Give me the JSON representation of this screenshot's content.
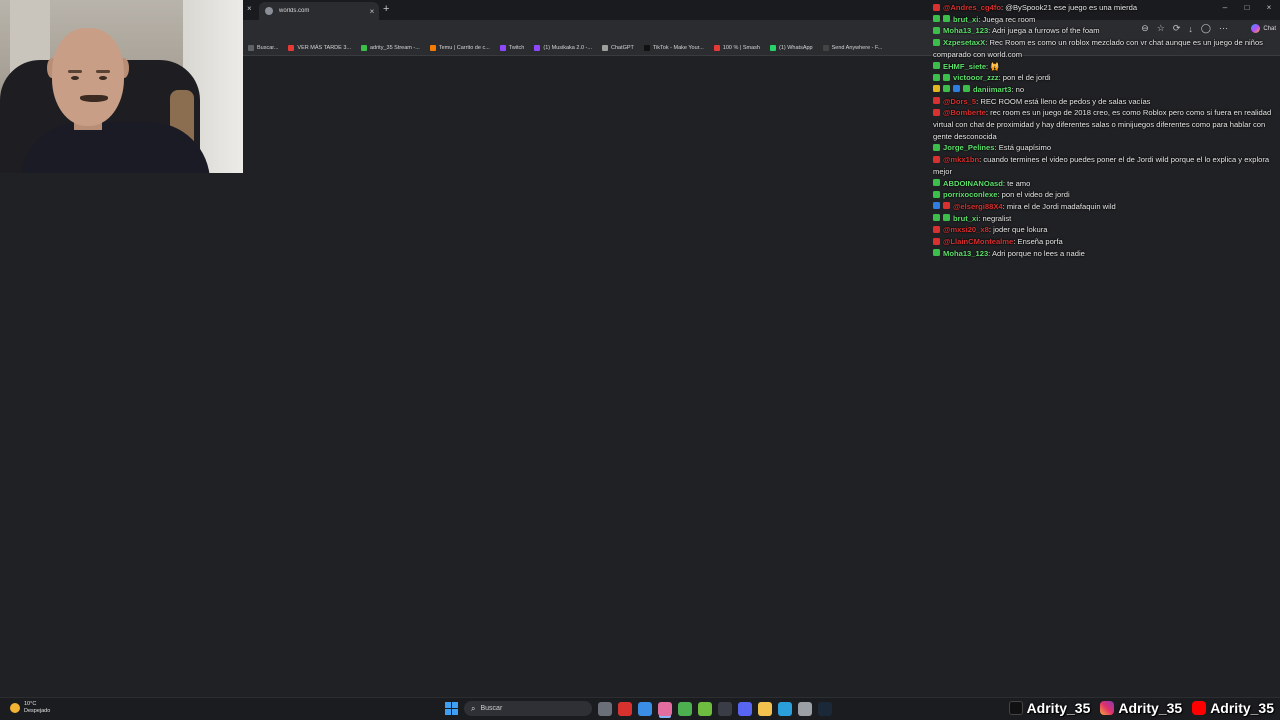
{
  "browser": {
    "tab_title": "worlds.com",
    "tab_close": "×",
    "new_tab": "+",
    "window_controls": [
      "–",
      "□",
      "×"
    ],
    "left_close": "×"
  },
  "toolbar": {
    "icons": [
      "⊖",
      "☆",
      "⟳",
      "↓",
      "◯",
      "⋯"
    ],
    "chat_label": "Chat"
  },
  "bookmarks": [
    {
      "label": "Buscar...",
      "color": "#5f6368"
    },
    {
      "label": "VER MÁS TARDE 3...",
      "color": "#e53935"
    },
    {
      "label": "adrity_35 Stream -...",
      "color": "#3bbf4a"
    },
    {
      "label": "Temu | Carrito de c...",
      "color": "#f57c00"
    },
    {
      "label": "Twitch",
      "color": "#9146ff"
    },
    {
      "label": "(1) Musikaka 2.0 -...",
      "color": "#9146ff"
    },
    {
      "label": "ChatGPT",
      "color": "#9e9e9e"
    },
    {
      "label": "TikTok - Make Your...",
      "color": "#111111"
    },
    {
      "label": "100 % | Smash",
      "color": "#e53935"
    },
    {
      "label": "(1) WhatsApp",
      "color": "#25d366"
    },
    {
      "label": "Send Anywhere - F...",
      "color": "#444444"
    }
  ],
  "chat": [
    {
      "user": "@Andres_cg4fo",
      "user_color": "#d93030",
      "badges": [
        "red"
      ],
      "text": ": @BySpook21 ese juego es una mierda"
    },
    {
      "user": "brut_xi",
      "user_color": "#5ee06c",
      "badges": [
        "green",
        "green"
      ],
      "text": ": Juega rec room"
    },
    {
      "user": "Moha13_123",
      "user_color": "#5ee06c",
      "badges": [
        "green"
      ],
      "text": ": Adri juega a furrows of the foam"
    },
    {
      "user": "XzpesetaxX",
      "user_color": "#5ee06c",
      "badges": [
        "green"
      ],
      "text": ": Rec Room es como un roblox mezclado con vr chat aunque es un juego de niños comparado con world.com"
    },
    {
      "user": "EHMF_siete",
      "user_color": "#5ee06c",
      "badges": [
        "green"
      ],
      "text": ": 🙀"
    },
    {
      "user": "victooor_zzz",
      "user_color": "#5ee06c",
      "badges": [
        "green",
        "green"
      ],
      "text": ": pon el de jordi"
    },
    {
      "user": "daniimart3",
      "user_color": "#5ee06c",
      "badges": [
        "yellow",
        "green",
        "blue",
        "green"
      ],
      "text": ": no"
    },
    {
      "user": "@Dors_5",
      "user_color": "#d93030",
      "badges": [
        "red"
      ],
      "text": ": REC ROOM está lleno de pedos y de salas vacías"
    },
    {
      "user": "@Bomberte",
      "user_color": "#d93030",
      "badges": [
        "red"
      ],
      "text": ": rec room es un juego de 2018 creo, es como Roblox pero como si fuera en realidad virtual con chat de proximidad y hay diferentes salas o minijuegos diferentes como para hablar con gente desconocida"
    },
    {
      "user": "Jorge_Pelines",
      "user_color": "#5ee06c",
      "badges": [
        "green"
      ],
      "text": ": Está guapísimo"
    },
    {
      "user": "@mkx1bn",
      "user_color": "#d93030",
      "badges": [
        "red"
      ],
      "text": ": cuando termines el video puedes poner el de Jordi wild porque el lo explica y explora mejor"
    },
    {
      "user": "ABDOINANOasd",
      "user_color": "#5ee06c",
      "badges": [
        "green"
      ],
      "text": ": te amo"
    },
    {
      "user": "porrixoconlexe",
      "user_color": "#5ee06c",
      "badges": [
        "green"
      ],
      "text": ": pon el video de jordi"
    },
    {
      "user": "@elsergi88X4",
      "user_color": "#d93030",
      "badges": [
        "blue",
        "red"
      ],
      "text": ": mira el de Jordi madafaquin wild"
    },
    {
      "user": "brut_xi",
      "user_color": "#5ee06c",
      "badges": [
        "green",
        "green"
      ],
      "text": ": negralist"
    },
    {
      "user": "@mxsi20_x8",
      "user_color": "#d93030",
      "badges": [
        "red"
      ],
      "text": ": joder que lokura"
    },
    {
      "user": "@LlainCMontealme",
      "user_color": "#d93030",
      "badges": [
        "red"
      ],
      "text": ": Enseña porfa"
    },
    {
      "user": "Moha13_123",
      "user_color": "#5ee06c",
      "badges": [
        "green"
      ],
      "text": ": Adri porque no lees a nadie"
    }
  ],
  "taskbar": {
    "weather_temp": "10°C",
    "weather_desc": "Despejado",
    "search_label": "Buscar",
    "apps": [
      {
        "name": "task-view-icon",
        "color": "#6b6f78"
      },
      {
        "name": "opera-icon",
        "color": "#d8322f"
      },
      {
        "name": "chrome-icon",
        "color": "#3a8ee6"
      },
      {
        "name": "notepad-icon",
        "color": "#e46da0"
      },
      {
        "name": "xbox-icon",
        "color": "#4caf50"
      },
      {
        "name": "app-green-icon",
        "color": "#6dbb3f"
      },
      {
        "name": "app-dark-icon",
        "color": "#3a3d45"
      },
      {
        "name": "discord-icon",
        "color": "#5865f2"
      },
      {
        "name": "file-explorer-icon",
        "color": "#f2c14e"
      },
      {
        "name": "edge-icon",
        "color": "#2b9fd9"
      },
      {
        "name": "settings-icon",
        "color": "#9aa0a6"
      },
      {
        "name": "steam-icon",
        "color": "#1b2838"
      }
    ]
  },
  "socials": [
    {
      "icon": "tiktok-icon",
      "handle": "Adrity_35"
    },
    {
      "icon": "instagram-icon",
      "handle": "Adrity_35"
    },
    {
      "icon": "youtube-icon",
      "handle": "Adrity_35"
    }
  ]
}
